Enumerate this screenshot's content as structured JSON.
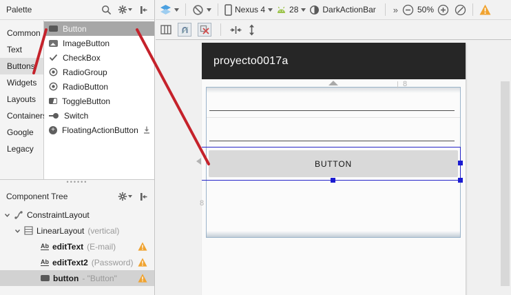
{
  "palette": {
    "title": "Palette",
    "categories": [
      "Common",
      "Text",
      "Buttons",
      "Widgets",
      "Layouts",
      "Containers",
      "Google",
      "Legacy"
    ],
    "selected_category": "Buttons",
    "items": [
      {
        "label": "Button",
        "icon": "button-icon",
        "selected": true
      },
      {
        "label": "ImageButton",
        "icon": "image-button-icon"
      },
      {
        "label": "CheckBox",
        "icon": "checkbox-icon"
      },
      {
        "label": "RadioGroup",
        "icon": "radio-icon"
      },
      {
        "label": "RadioButton",
        "icon": "radio-icon"
      },
      {
        "label": "ToggleButton",
        "icon": "toggle-icon"
      },
      {
        "label": "Switch",
        "icon": "switch-icon"
      },
      {
        "label": "FloatingActionButton",
        "icon": "fab-icon",
        "download": true
      }
    ]
  },
  "toolbar": {
    "device_label": "Nexus 4",
    "api_level": "28",
    "theme": "DarkActionBar",
    "overflow_chevrons": "»",
    "zoom_percent": "50%"
  },
  "canvas": {
    "app_title": "proyecto0017a",
    "button_label": "BUTTON",
    "margin_top": "8",
    "margin_left": "8"
  },
  "tree": {
    "title": "Component Tree",
    "nodes": [
      {
        "label": "ConstraintLayout",
        "icon": "constraint-layout-icon"
      },
      {
        "label": "LinearLayout",
        "suffix": "(vertical)",
        "icon": "linear-layout-icon"
      },
      {
        "label": "editText",
        "suffix": "(E-mail)",
        "icon": "edittext-icon",
        "warning": true
      },
      {
        "label": "editText2",
        "suffix": "(Password)",
        "icon": "edittext-icon",
        "warning": true
      },
      {
        "label": "button",
        "suffix": "- \"Button\"",
        "icon": "button-icon",
        "warning": true,
        "selected": true
      }
    ]
  },
  "colors": {
    "selection_blue": "#2424c8",
    "warning_orange": "#f0a330",
    "annotation_red": "#c5222b",
    "actionbar_dark": "#262626"
  }
}
